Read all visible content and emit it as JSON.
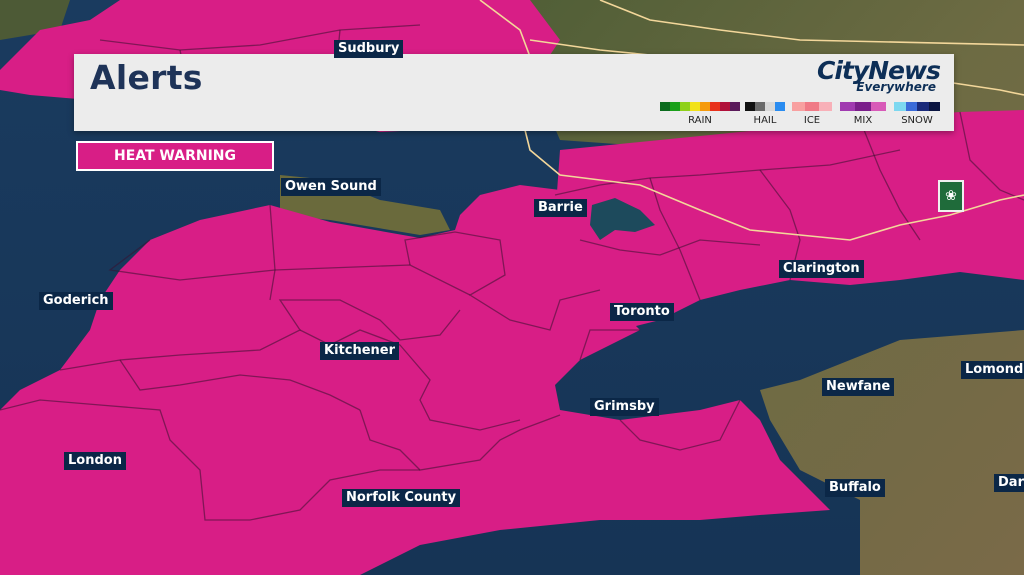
{
  "panel": {
    "title": "Alerts",
    "brand_name": "CityNews",
    "brand_tagline": "Everywhere"
  },
  "legend": [
    {
      "label": "RAIN",
      "colors": [
        "#0b6b1e",
        "#1aa01a",
        "#8fd11a",
        "#f2e21a",
        "#f59a0c",
        "#e8321c",
        "#b0103a",
        "#5a1a5a"
      ]
    },
    {
      "label": "HAIL",
      "colors": [
        "#111111",
        "#6a6a6a",
        "#d8d8d8",
        "#2a8cf0"
      ]
    },
    {
      "label": "ICE",
      "colors": [
        "#f8a0a0",
        "#f07a86",
        "#f8b0b8"
      ]
    },
    {
      "label": "MIX",
      "colors": [
        "#a03ab0",
        "#7a1e8a",
        "#d85ab8"
      ]
    },
    {
      "label": "SNOW",
      "colors": [
        "#7cd8f0",
        "#3a6ad8",
        "#1a2a7a",
        "#0a1440"
      ]
    }
  ],
  "alert": {
    "label": "HEAT WARNING",
    "color": "#d81e86"
  },
  "cities": [
    {
      "id": "sudbury",
      "label": "Sudbury"
    },
    {
      "id": "owen-sound",
      "label": "Owen Sound"
    },
    {
      "id": "barrie",
      "label": "Barrie"
    },
    {
      "id": "clarington",
      "label": "Clarington"
    },
    {
      "id": "goderich",
      "label": "Goderich"
    },
    {
      "id": "toronto",
      "label": "Toronto"
    },
    {
      "id": "kitchener",
      "label": "Kitchener"
    },
    {
      "id": "lomond",
      "label": "Lomond"
    },
    {
      "id": "newfane",
      "label": "Newfane"
    },
    {
      "id": "grimsby",
      "label": "Grimsby"
    },
    {
      "id": "london",
      "label": "London"
    },
    {
      "id": "norfolk-county",
      "label": "Norfolk County"
    },
    {
      "id": "buffalo",
      "label": "Buffalo"
    },
    {
      "id": "dar",
      "label": "Dar"
    }
  ],
  "colors": {
    "warning": "#d81e86",
    "water": "#1b3f66",
    "land": "#5c6a3c",
    "panel_text": "#1e3358",
    "label_bg": "#0b2747"
  }
}
